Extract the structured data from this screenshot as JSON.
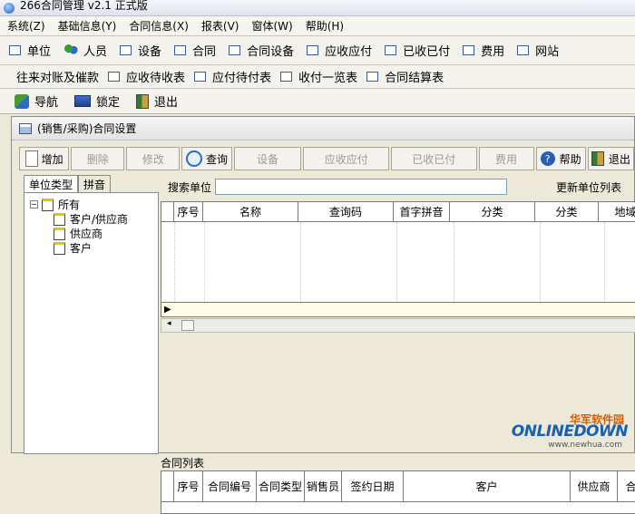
{
  "window": {
    "title": "266合同管理 v2.1 正式版"
  },
  "menu": [
    "系统(Z)",
    "基础信息(Y)",
    "合同信息(X)",
    "报表(V)",
    "窗体(W)",
    "帮助(H)"
  ],
  "nav_row1": [
    "单位",
    "人员",
    "设备",
    "合同",
    "合同设备",
    "应收应付",
    "已收已付",
    "费用",
    "网站"
  ],
  "nav_row2": {
    "prefix": "往来对账及催款",
    "items": [
      "应收待收表",
      "应付待付表",
      "收付一览表",
      "合同结算表"
    ]
  },
  "toolbar": {
    "nav": "导航",
    "lock": "锁定",
    "exit": "退出"
  },
  "child": {
    "title": "(销售/采购)合同设置",
    "buttons": {
      "add": "增加",
      "delete": "删除",
      "edit": "修改",
      "search": "查询",
      "device": "设备",
      "receivable": "应收应付",
      "received": "已收已付",
      "fee": "费用",
      "help": "帮助",
      "exit": "退出"
    },
    "left_tabs": [
      "单位类型",
      "拼音"
    ],
    "tree": {
      "root": "所有",
      "children": [
        "客户/供应商",
        "供应商",
        "客户"
      ]
    },
    "search": {
      "label": "搜索单位",
      "value": "",
      "refresh": "更新单位列表"
    },
    "unit_columns": [
      "序号",
      "名称",
      "查询码",
      "首字拼音",
      "分类",
      "分类",
      "地域"
    ],
    "list_label": "合同列表",
    "contract_columns": [
      "序号",
      "合同编号",
      "合同类型",
      "销售员",
      "签约日期",
      "客户",
      "供应商",
      "合"
    ]
  },
  "watermark": {
    "line1": "华军软件园",
    "line2": "ONLINEDOWN",
    "line3": "www.newhua.com"
  }
}
